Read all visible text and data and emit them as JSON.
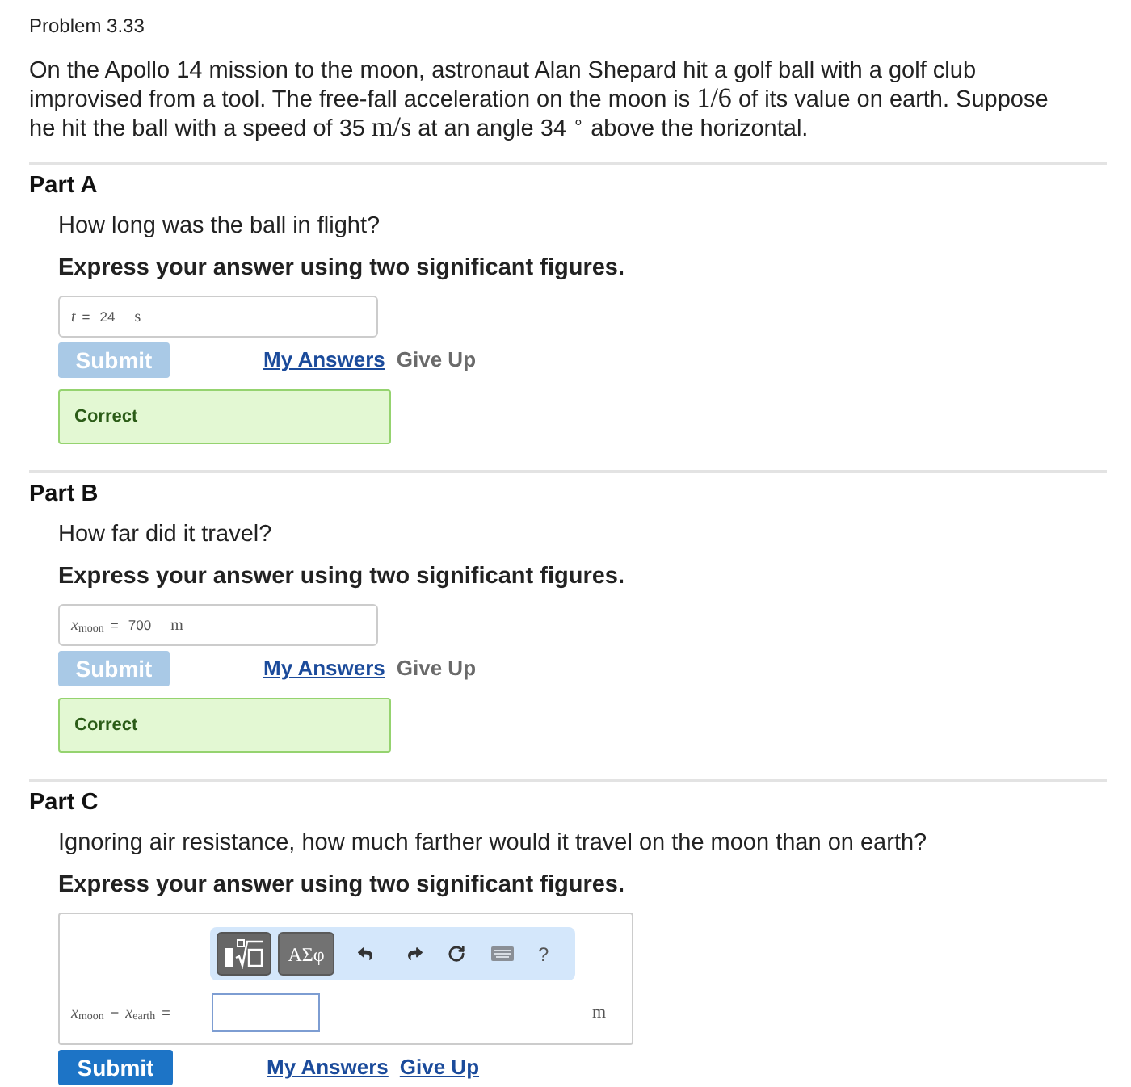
{
  "problem": {
    "title": "Problem 3.33",
    "statement": [
      {
        "kind": "text",
        "text": "On the Apollo 14 mission to the moon, astronaut Alan Shepard hit a golf ball with a golf club improvised from a tool. The free-fall acceleration on the moon is "
      },
      {
        "kind": "math",
        "text": "1/6"
      },
      {
        "kind": "text",
        "text": " of its value on earth. Suppose he hit the ball with a speed of 35 "
      },
      {
        "kind": "math",
        "text": "m/s"
      },
      {
        "kind": "text",
        "text": " at an angle 34 $^{∘}$ above the horizontal."
      }
    ]
  },
  "parts": [
    {
      "label": "Part A",
      "question": "How long was the ball in flight?",
      "instruction": "Express your answer using two significant figures.",
      "answer": {
        "kind": "filled",
        "label": [
          {
            "kind": "var",
            "symbol": "t"
          },
          {
            "kind": "op",
            "text": "="
          }
        ],
        "value": "24",
        "unit": "s"
      },
      "submit": {
        "label": "Submit",
        "disabled": true
      },
      "links": [
        {
          "label": "My Answers",
          "disabled": false
        },
        {
          "label": "Give Up",
          "disabled": true
        }
      ],
      "feedback": {
        "kind": "correct",
        "text": "Correct"
      }
    },
    {
      "label": "Part B",
      "question": "How far did it travel?",
      "instruction": "Express your answer using two significant figures.",
      "answer": {
        "kind": "filled",
        "label": [
          {
            "kind": "var",
            "symbol": "x",
            "subscript": "moon"
          },
          {
            "kind": "op",
            "text": "="
          }
        ],
        "value": "700",
        "unit": "m"
      },
      "submit": {
        "label": "Submit",
        "disabled": true
      },
      "links": [
        {
          "label": "My Answers",
          "disabled": false
        },
        {
          "label": "Give Up",
          "disabled": true
        }
      ],
      "feedback": {
        "kind": "correct",
        "text": "Correct"
      }
    },
    {
      "label": "Part C",
      "question": "Ignoring air resistance, how much farther would it travel on the moon than on earth?",
      "instruction": "Express your answer using two significant figures.",
      "answer": {
        "kind": "editor",
        "toolbar": [
          {
            "kind": "templates"
          },
          {
            "kind": "symbols",
            "text": "ΑΣφ"
          },
          {
            "kind": "undo"
          },
          {
            "kind": "redo"
          },
          {
            "kind": "reset"
          },
          {
            "kind": "keyboard"
          },
          {
            "kind": "help",
            "text": "?"
          }
        ],
        "label": [
          {
            "kind": "var",
            "symbol": "x",
            "subscript": "moon"
          },
          {
            "kind": "op",
            "text": "−"
          },
          {
            "kind": "var",
            "symbol": "x",
            "subscript": "earth"
          },
          {
            "kind": "op",
            "text": "="
          }
        ],
        "unit": "m"
      },
      "submit": {
        "label": "Submit",
        "disabled": false
      },
      "links": [
        {
          "label": "My Answers",
          "disabled": false
        },
        {
          "label": "Give Up",
          "disabled": false
        }
      ]
    }
  ]
}
